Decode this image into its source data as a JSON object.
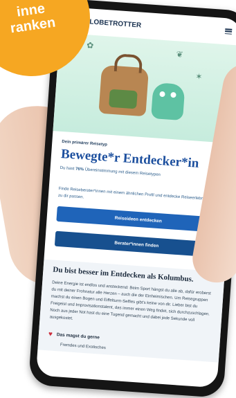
{
  "badge": {
    "line1": "inne",
    "line2": "ranken"
  },
  "app": {
    "logo": "GLOBETROTTER"
  },
  "result": {
    "kicker": "Dein primärer Reisetyp",
    "type_title": "Bewegte*r Entdecker*in",
    "match_prefix": "Du hast ",
    "match_value": "76%",
    "match_suffix": " Übereinstimmung mit diesem Reisetypen",
    "advisor_text": "Finde Reiseberater*innen mit einem ähnlichen Profil und entdecke Reiseerlebnisse, die zu dir passen.",
    "button_ideas": "Reiseideen entdecken",
    "button_advisors": "Berater*innen finden"
  },
  "section": {
    "heading": "Du bist besser im Entdecken als Kolumbus.",
    "body": "Deine Energie ist endlos und ansteckend: Beim Sport hängst du alle ab, dafür eroberst du mit deiner Frohnatur alle Herzen – auch die der Einheimischen. Um Reisegruppen machst du einen Bogen und Eiffelturm-Selfies gibt's keine von dir. Lieber bist du Freigeist und Improvisationstalent, das immer einen Weg findet, sich durchzuschlagen. Noch aus jeder Not hast du eine Tugend gemacht und dabei jede Sekunde voll ausgekostet.",
    "likes_title": "Das magst du gerne",
    "likes_item": "Fremdes und Exotisches"
  },
  "icons": {
    "menu": "hamburger-menu-icon",
    "like": "heart-icon"
  }
}
